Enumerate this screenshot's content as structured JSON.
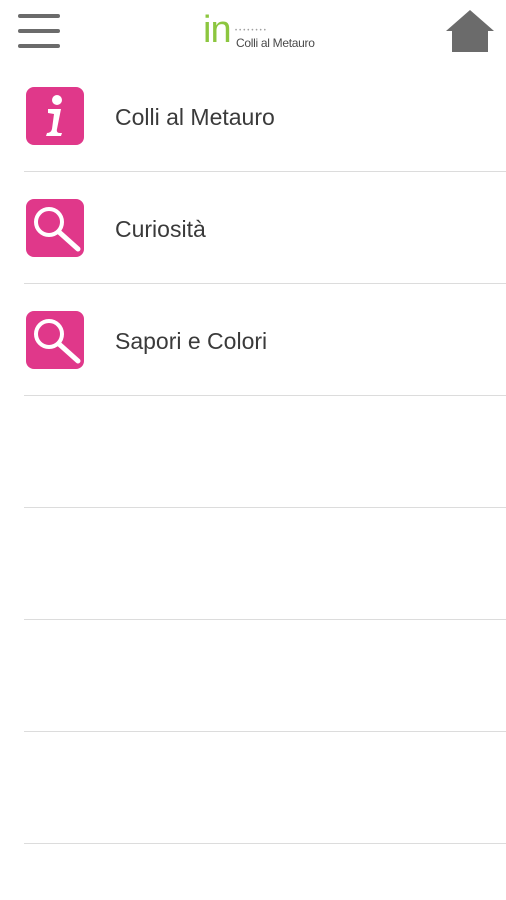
{
  "header": {
    "logo": {
      "mark": "in",
      "subtitle": "Colli al Metauro",
      "mark_color": "#8cc63f"
    },
    "menu_icon": "hamburger-menu-icon",
    "home_icon": "home-icon"
  },
  "menu": {
    "accent_color": "#e0388a",
    "items": [
      {
        "label": "Colli al Metauro",
        "icon": "info-icon"
      },
      {
        "label": "Curiosità",
        "icon": "magnifier-icon"
      },
      {
        "label": "Sapori e Colori",
        "icon": "magnifier-icon"
      }
    ]
  }
}
